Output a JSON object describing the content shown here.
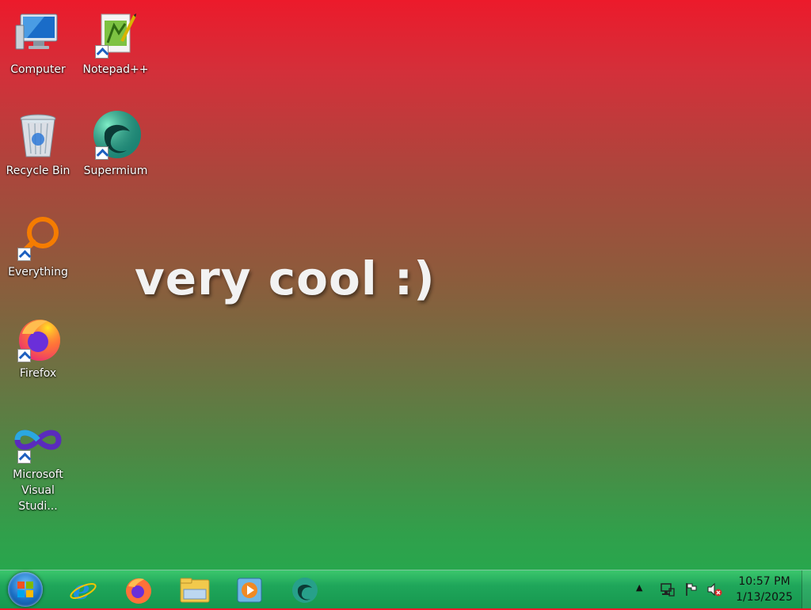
{
  "desktop": {
    "icons": [
      {
        "label": "Computer"
      },
      {
        "label": "Notepad++"
      },
      {
        "label": "Recycle Bin"
      },
      {
        "label": "Supermium"
      },
      {
        "label": "Everything"
      },
      {
        "label": "Firefox"
      },
      {
        "label": "Microsoft\nVisual Studi..."
      }
    ],
    "overlay_text": "very cool :)"
  },
  "taskbar": {
    "start_icon": "windows-logo-icon",
    "pinned": [
      {
        "name": "internet-explorer-icon"
      },
      {
        "name": "firefox-icon"
      },
      {
        "name": "file-explorer-icon"
      },
      {
        "name": "media-player-icon"
      },
      {
        "name": "supermium-icon"
      }
    ],
    "tray": {
      "show_hidden": "▲",
      "network_icon": "network-icon",
      "flag_icon": "action-center-flag-icon",
      "volume_icon": "volume-muted-icon"
    },
    "clock": {
      "time": "10:57 PM",
      "date": "1/13/2025"
    }
  },
  "colors": {
    "gradient_top": "#ec1a2b",
    "gradient_bottom": "#1fad4f",
    "taskbar": "#1fa65a"
  }
}
